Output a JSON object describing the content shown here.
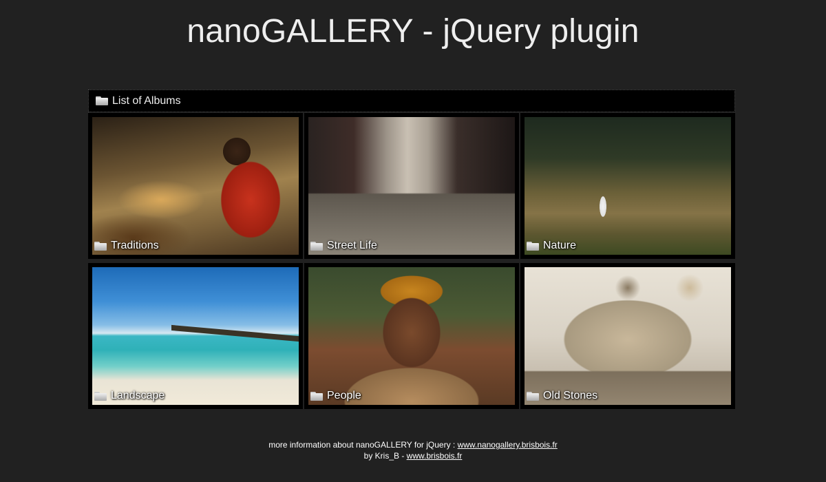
{
  "header": {
    "title": "nanoGALLERY - jQuery plugin"
  },
  "breadcrumb": {
    "icon": "folder-icon",
    "label": "List of Albums"
  },
  "albums": [
    {
      "label": "Traditions",
      "icon": "folder-icon"
    },
    {
      "label": "Street Life",
      "icon": "folder-icon"
    },
    {
      "label": "Nature",
      "icon": "folder-icon"
    },
    {
      "label": "Landscape",
      "icon": "folder-icon"
    },
    {
      "label": "People",
      "icon": "folder-icon"
    },
    {
      "label": "Old Stones",
      "icon": "folder-icon"
    }
  ],
  "footer": {
    "line1_prefix": "more information about nanoGALLERY for jQuery : ",
    "line1_link": "www.nanogallery.brisbois.fr",
    "line2_prefix": "by Kris_B - ",
    "line2_link": "www.brisbois.fr"
  },
  "colors": {
    "background": "#212121",
    "panel": "#000000",
    "text": "#eeeeee"
  }
}
